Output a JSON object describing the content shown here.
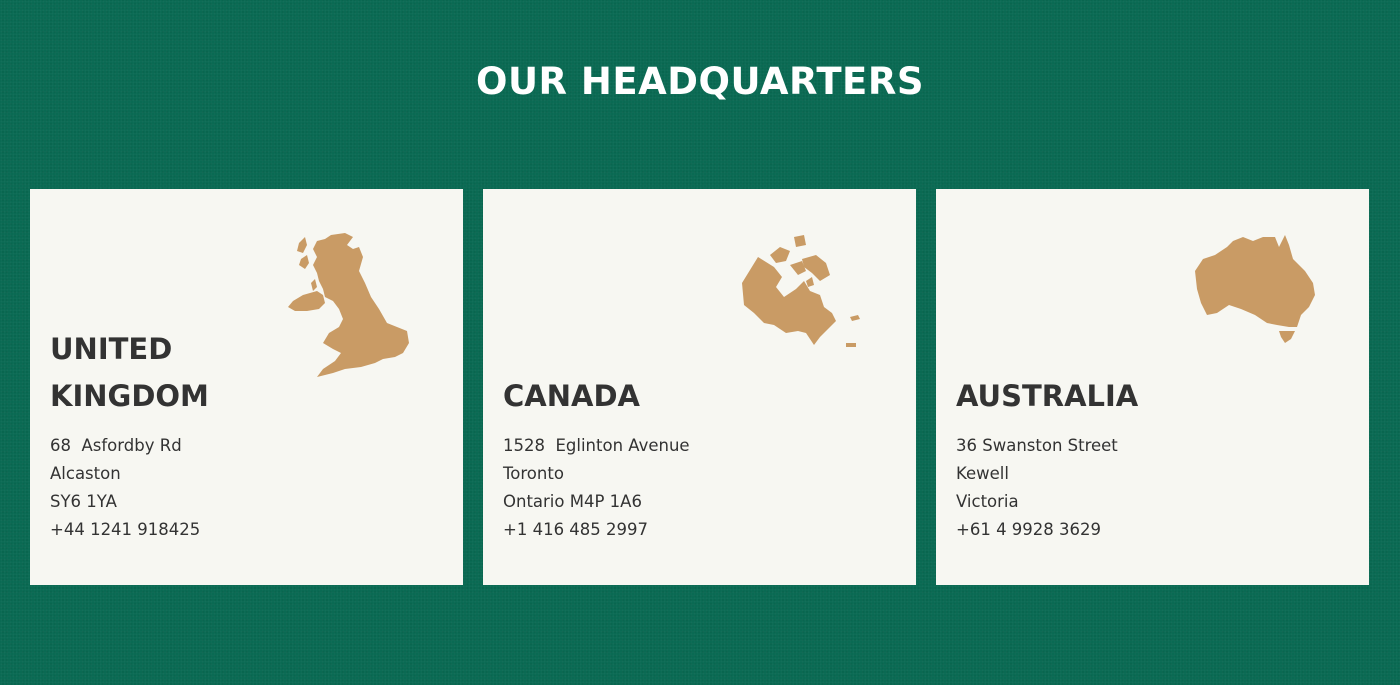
{
  "header": {
    "title": "OUR HEADQUARTERS"
  },
  "colors": {
    "background": "#0a6a53",
    "card": "#f7f7f2",
    "map": "#c99b65",
    "text": "#333333"
  },
  "offices": [
    {
      "country": "UNITED KINGDOM",
      "map_icon": "uk-map-icon",
      "address": [
        "68  Asfordby Rd",
        "Alcaston",
        "SY6 1YA"
      ],
      "phone": "+44 1241 918425"
    },
    {
      "country": "CANADA",
      "map_icon": "canada-map-icon",
      "address": [
        "1528  Eglinton Avenue",
        "Toronto",
        "Ontario M4P 1A6"
      ],
      "phone": "+1 416 485 2997"
    },
    {
      "country": "AUSTRALIA",
      "map_icon": "australia-map-icon",
      "address": [
        "36 Swanston Street",
        "Kewell",
        "Victoria"
      ],
      "phone": "+61 4 9928 3629"
    }
  ]
}
